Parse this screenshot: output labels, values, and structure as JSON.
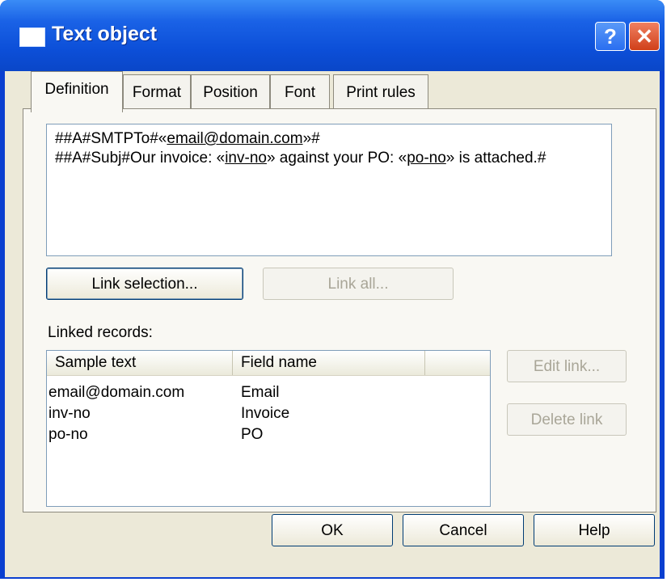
{
  "window": {
    "title": "Text object",
    "help_glyph": "?",
    "close_glyph": "✕"
  },
  "tabs": [
    {
      "label": "Definition",
      "active": true
    },
    {
      "label": "Format",
      "active": false
    },
    {
      "label": "Position",
      "active": false
    },
    {
      "label": "Font",
      "active": false
    },
    {
      "label": "Print rules",
      "active": false
    }
  ],
  "definition": {
    "line1": {
      "prefix": "##A#SMTPTo#",
      "open": "«",
      "link": "email@domain.com",
      "close": "»",
      "suffix": "#"
    },
    "line2": {
      "prefix": "##A#Subj#Our invoice: ",
      "open1": "«",
      "link1": "inv-no",
      "close1": "»",
      "middle": " against your PO: ",
      "open2": "«",
      "link2": "po-no",
      "close2": "»",
      "suffix": " is attached.#"
    }
  },
  "buttons": {
    "link_selection": "Link selection...",
    "link_all": "Link all...",
    "edit_link": "Edit link...",
    "delete_link": "Delete link",
    "ok": "OK",
    "cancel": "Cancel",
    "help": "Help"
  },
  "linked_records": {
    "label": "Linked records:",
    "columns": [
      "Sample text",
      "Field name",
      ""
    ],
    "rows": [
      {
        "sample": "email@domain.com",
        "field": "Email"
      },
      {
        "sample": "inv-no",
        "field": "Invoice"
      },
      {
        "sample": "po-no",
        "field": "PO"
      }
    ]
  },
  "colors": {
    "title_bar": "#0a46c8",
    "dialog_bg": "#ece9d8",
    "close_button": "#d0401a"
  }
}
